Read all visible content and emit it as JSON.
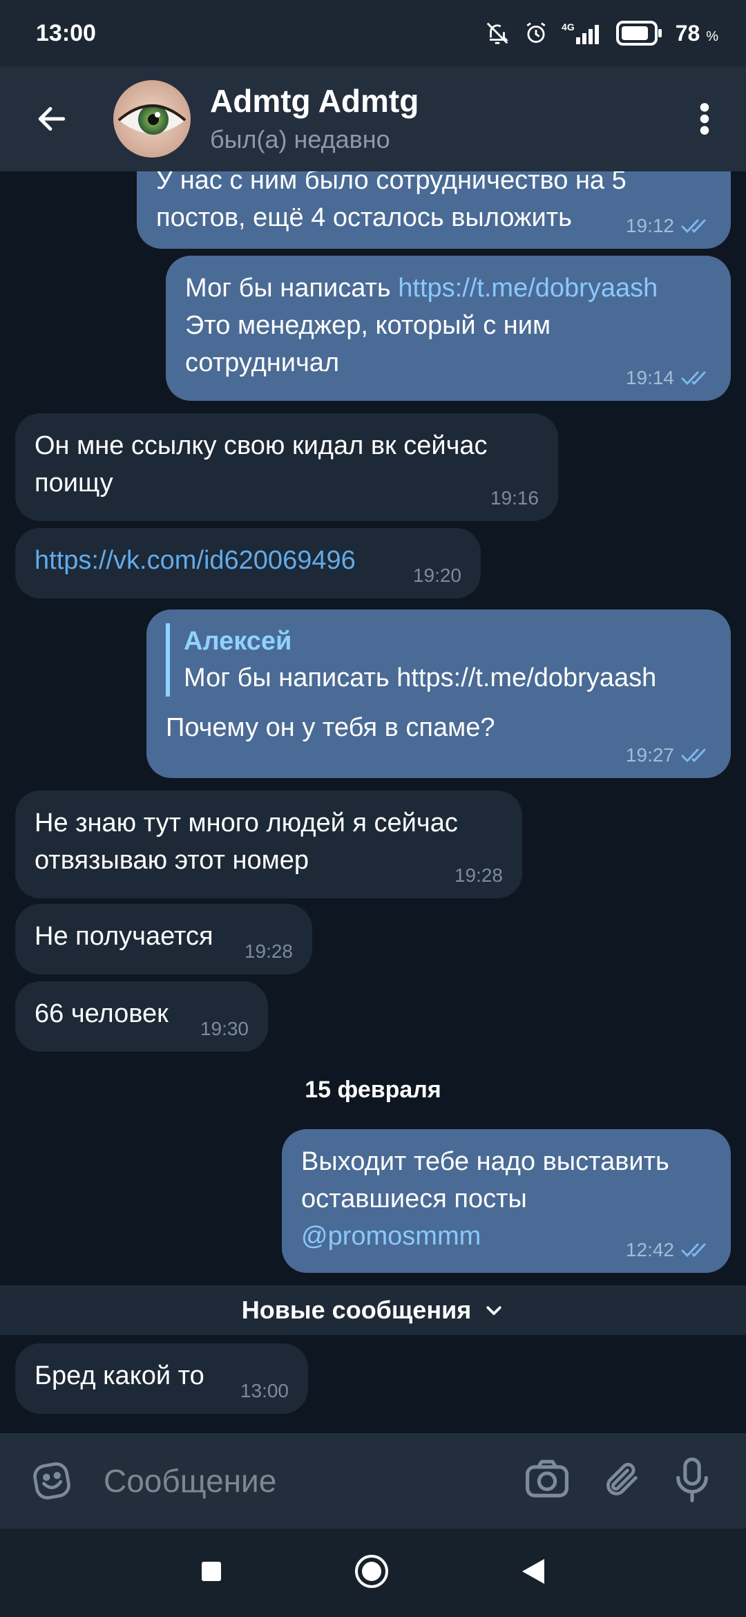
{
  "status_bar": {
    "time": "13:00",
    "network": "4G",
    "battery": "78",
    "battery_unit": "%"
  },
  "header": {
    "title": "Admtg Admtg",
    "status": "был(а) недавно"
  },
  "messages": [
    {
      "dir": "out",
      "text": "У нас с ним было сотрудничество на 5\nпостов, ещё 4 осталось выложить",
      "time": "19:12"
    },
    {
      "dir": "out",
      "prefix": "Мог бы написать ",
      "link": "https://t.me/dobryaash",
      "suffix": "\nЭто менеджер, который с ним\nсотрудничал",
      "time": "19:14"
    },
    {
      "dir": "in",
      "text": "Он мне ссылку свою кидал вк сейчас\nпоищу",
      "time": "19:16"
    },
    {
      "dir": "in",
      "link": "https://vk.com/id620069496",
      "time": "19:20"
    },
    {
      "dir": "out",
      "reply_name": "Алексей",
      "reply_text": "Мог бы написать https://t.me/dobryaash",
      "text": "Почему он у тебя в спаме?",
      "time": "19:27"
    },
    {
      "dir": "in",
      "text": "Не знаю тут много людей я сейчас\nотвязываю этот номер",
      "time": "19:28"
    },
    {
      "dir": "in",
      "text": "Не получается",
      "time": "19:28"
    },
    {
      "dir": "in",
      "text": "66 человек",
      "time": "19:30"
    },
    {
      "dir": "out",
      "text": "Выходит тебе надо выставить\nоставшиеся посты",
      "link": "@promosmmm",
      "time": "12:42"
    },
    {
      "dir": "in",
      "text": "Бред какой то",
      "time": "13:00"
    }
  ],
  "date_separator": "15 февраля",
  "new_messages_label": "Новые сообщения",
  "input": {
    "placeholder": "Сообщение"
  },
  "icons": {
    "back": "arrow-left-icon",
    "menu": "more-vertical-icon",
    "emoji": "emoji-icon",
    "camera": "camera-icon",
    "attach": "paperclip-icon",
    "mic": "microphone-icon",
    "read": "double-check-icon"
  },
  "colors": {
    "background": "#0e1621",
    "header": "#242f3d",
    "outgoing_bubble": "#4a6b95",
    "incoming_bubble": "#1d2936",
    "link": "#62abeb",
    "reply_accent": "#8fd3ff"
  }
}
